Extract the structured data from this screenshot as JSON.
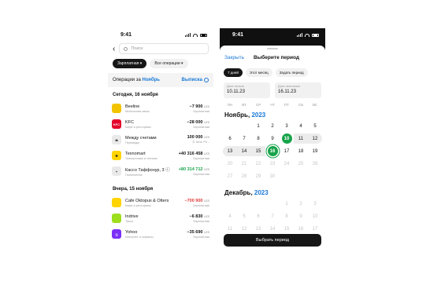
{
  "left": {
    "status": {
      "time": "9:41"
    },
    "search": {
      "placeholder": "Поиск"
    },
    "chips": [
      {
        "label": "Зарплатная ▾"
      },
      {
        "label": "Все операции ▾"
      }
    ],
    "operations": {
      "prefix": "Операции за",
      "month": "Ноябрь",
      "statement": "Выписка"
    },
    "groups": [
      {
        "title": "Сегодня, 16 ноября",
        "items": [
          {
            "name": "Beeline",
            "category": "Мобильная связь",
            "amount": "−7 900",
            "currency": "UZS",
            "account": "Зарплатная",
            "icon_text": "",
            "icon_color": "#f2c400",
            "amount_color": "#111111"
          },
          {
            "name": "KFC",
            "category": "Кафе и рестораны",
            "amount": "−28 000",
            "currency": "UZS",
            "account": "Зарплатная",
            "icon_text": "KFC",
            "icon_color": "#e4002b",
            "amount_color": "#111111"
          },
          {
            "name": "Между счетами",
            "category": "Переводы",
            "amount": "100 000",
            "currency": "UZS",
            "account": "Ⓢ Апхо Ро...",
            "icon_text": "⇆",
            "icon_color": "#e9e9e9",
            "amount_color": "#111111"
          },
          {
            "name": "Texnomart",
            "category": "Электроника и техника",
            "amount": "+40 316 458",
            "currency": "UZS",
            "account": "Зарплатная",
            "icon_text": "✱",
            "icon_color": "#ffd400",
            "amount_color": "#111111"
          },
          {
            "name": "Кассо Таффонур, 3 ⓘ",
            "category": "Пополнение",
            "amount": "+80 314 712",
            "currency": "UZS",
            "account": "Зарплатная",
            "icon_text": "+",
            "icon_color": "#e9e9e9",
            "amount_color": "#17a34a"
          }
        ]
      },
      {
        "title": "Вчера, 15 ноября",
        "items": [
          {
            "name": "Cafe Oktopus & Otters",
            "category": "Кафе и рестораны",
            "amount": "−700 900",
            "currency": "UZS",
            "account": "Зарплатная",
            "icon_text": "",
            "icon_color": "#ffd400",
            "amount_color": "#e33a3a"
          },
          {
            "name": "Indrive",
            "category": "Такси",
            "amount": "−6 830",
            "currency": "UZS",
            "account": "Зарплатная",
            "icon_text": "",
            "icon_color": "#9dde1d",
            "amount_color": "#111111"
          },
          {
            "name": "Yohoo",
            "category": "Интернет и сервисы",
            "amount": "−35 690",
            "currency": "UZS",
            "account": "Зарплатная",
            "icon_text": "Q",
            "icon_color": "#7b2ff7",
            "amount_color": "#111111"
          }
        ]
      }
    ]
  },
  "right": {
    "status": {
      "time": "9:41"
    },
    "header": {
      "close": "Закрыть",
      "title": "Выберите период"
    },
    "presets": [
      "7 дней",
      "Этот месяц",
      "Задать период"
    ],
    "start": {
      "label": "Дата начала",
      "value": "10.11.23"
    },
    "end": {
      "label": "Дата окончания",
      "value": "16.11.23"
    },
    "weekdays": [
      "ПН",
      "ВТ",
      "СР",
      "ЧТ",
      "ПТ",
      "СБ",
      "ВС"
    ],
    "months": [
      {
        "name": "Ноябрь,",
        "year": "2023",
        "rows": [
          [
            [
              "",
              ""
            ],
            [
              "",
              ""
            ],
            [
              "1",
              ""
            ],
            [
              "2",
              ""
            ],
            [
              "3",
              ""
            ],
            [
              "4",
              ""
            ],
            [
              "5",
              ""
            ]
          ],
          [
            [
              "6",
              ""
            ],
            [
              "7",
              ""
            ],
            [
              "8",
              ""
            ],
            [
              "9",
              ""
            ],
            [
              "10",
              "sel"
            ],
            [
              "11",
              "rng"
            ],
            [
              "12",
              "re"
            ]
          ],
          [
            [
              "13",
              "rs"
            ],
            [
              "14",
              "rng"
            ],
            [
              "15",
              "rng"
            ],
            [
              "16",
              "selring"
            ],
            [
              "17",
              ""
            ],
            [
              "18",
              ""
            ],
            [
              "19",
              ""
            ]
          ],
          [
            [
              "20",
              "dim"
            ],
            [
              "21",
              "dim"
            ],
            [
              "22",
              "dim"
            ],
            [
              "23",
              "dim"
            ],
            [
              "24",
              "dim"
            ],
            [
              "25",
              "dim"
            ],
            [
              "26",
              "dim"
            ]
          ],
          [
            [
              "27",
              "dim"
            ],
            [
              "28",
              "dim"
            ],
            [
              "29",
              "dim"
            ],
            [
              "30",
              "dim"
            ],
            [
              "",
              ""
            ],
            [
              "",
              ""
            ],
            [
              "",
              ""
            ]
          ]
        ]
      },
      {
        "name": "Декабрь,",
        "year": "2023",
        "rows": [
          [
            [
              "",
              ""
            ],
            [
              "",
              ""
            ],
            [
              "",
              ""
            ],
            [
              "",
              ""
            ],
            [
              "1",
              "dim"
            ],
            [
              "2",
              "dim"
            ],
            [
              "3",
              "dim"
            ]
          ],
          [
            [
              "4",
              "dim"
            ],
            [
              "5",
              "dim"
            ],
            [
              "6",
              "dim"
            ],
            [
              "7",
              "dim"
            ],
            [
              "8",
              "dim"
            ],
            [
              "9",
              "dim"
            ],
            [
              "10",
              "dim"
            ]
          ],
          [
            [
              "11",
              "dim"
            ],
            [
              "12",
              "dim"
            ],
            [
              "13",
              "dim"
            ],
            [
              "14",
              "dim"
            ],
            [
              "15",
              "dim"
            ],
            [
              "16",
              "dim"
            ],
            [
              "17",
              "dim"
            ]
          ],
          [
            [
              "18",
              "dim"
            ],
            [
              "19",
              "dim"
            ],
            [
              "20",
              "dim"
            ],
            [
              "21",
              "dim"
            ],
            [
              "22",
              "dim"
            ],
            [
              "23",
              "dim"
            ],
            [
              "24",
              "dim"
            ]
          ]
        ]
      }
    ],
    "apply": "Выбрать период"
  }
}
